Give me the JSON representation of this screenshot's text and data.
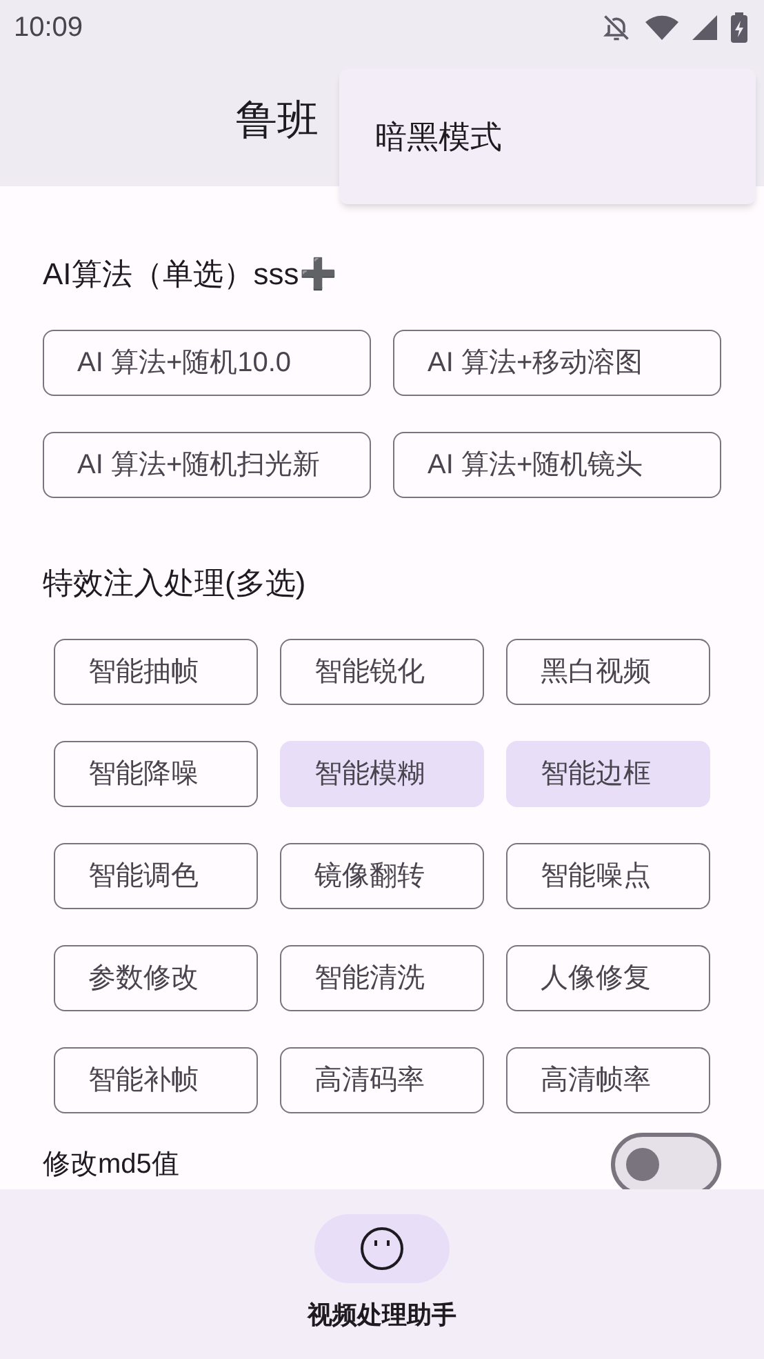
{
  "status_bar": {
    "time": "10:09"
  },
  "app_bar": {
    "title": "鲁班"
  },
  "menu": {
    "items": [
      {
        "label": "暗黑模式"
      }
    ]
  },
  "ai_section": {
    "title": "AI算法（单选）sss➕",
    "options": [
      {
        "label": "AI 算法+随机10.0",
        "selected": false
      },
      {
        "label": "AI 算法+移动溶图",
        "selected": false
      },
      {
        "label": "AI 算法+随机扫光新",
        "selected": false
      },
      {
        "label": "AI 算法+随机镜头",
        "selected": false
      }
    ]
  },
  "effects_section": {
    "title": "特效注入处理(多选)",
    "chips": [
      {
        "label": "智能抽帧",
        "selected": false
      },
      {
        "label": "智能锐化",
        "selected": false
      },
      {
        "label": "黑白视频",
        "selected": false
      },
      {
        "label": "智能降噪",
        "selected": false
      },
      {
        "label": "智能模糊",
        "selected": true
      },
      {
        "label": "智能边框",
        "selected": true
      },
      {
        "label": "智能调色",
        "selected": false
      },
      {
        "label": "镜像翻转",
        "selected": false
      },
      {
        "label": "智能噪点",
        "selected": false
      },
      {
        "label": "参数修改",
        "selected": false
      },
      {
        "label": "智能清洗",
        "selected": false
      },
      {
        "label": "人像修复",
        "selected": false
      },
      {
        "label": "智能补帧",
        "selected": false
      },
      {
        "label": "高清码率",
        "selected": false
      },
      {
        "label": "高清帧率",
        "selected": false
      }
    ]
  },
  "md5_toggle": {
    "label": "修改md5值",
    "on": false
  },
  "bottom_nav": {
    "items": [
      {
        "label": "视频处理助手",
        "selected": true
      }
    ]
  }
}
